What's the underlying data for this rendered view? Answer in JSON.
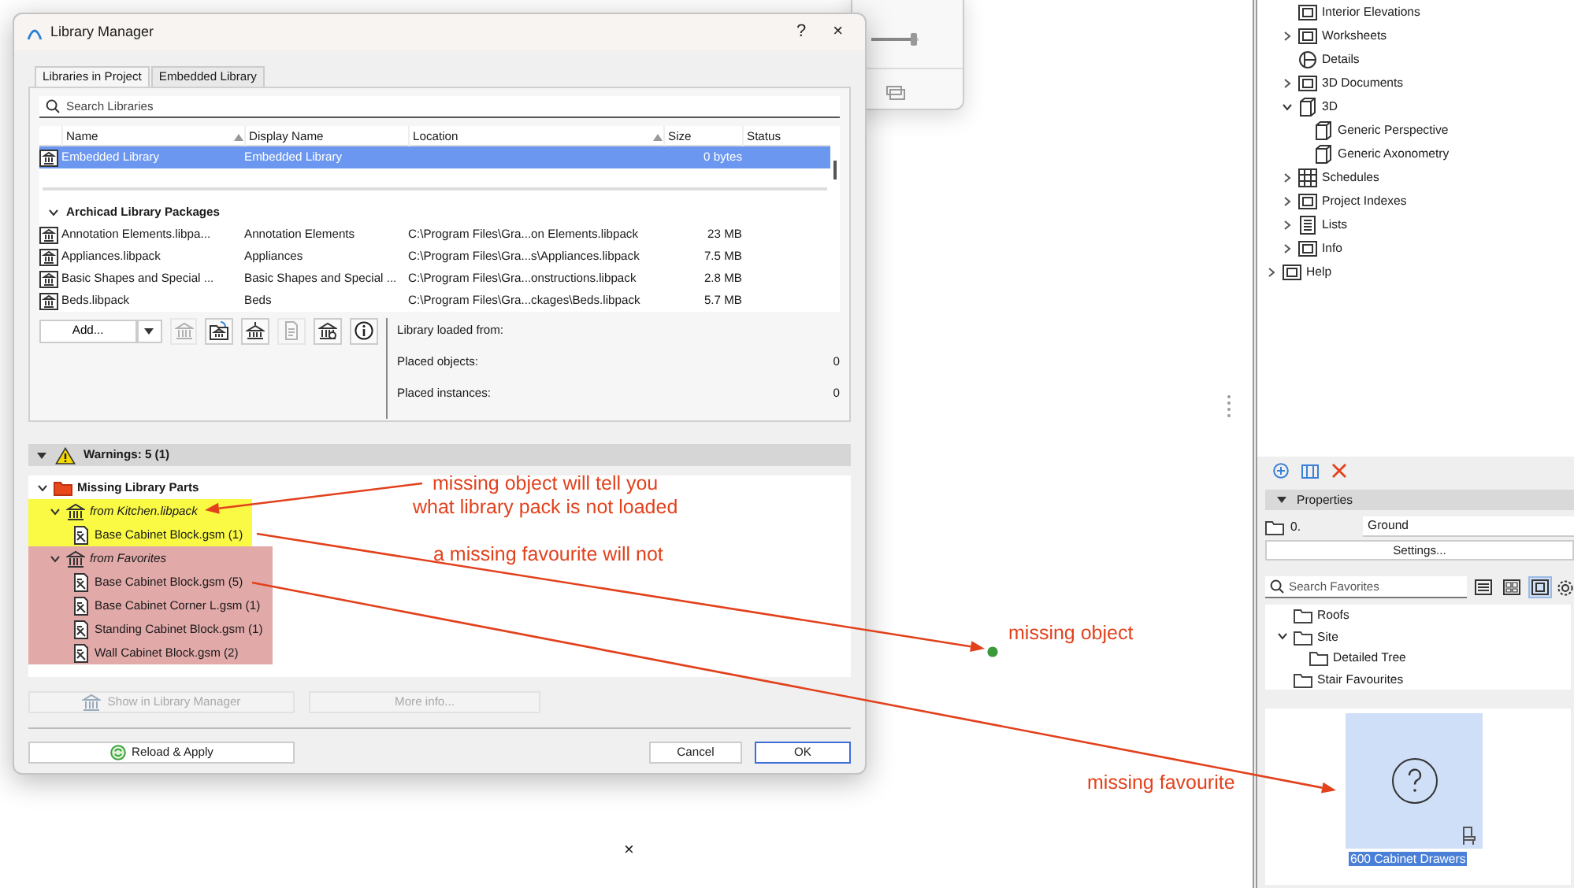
{
  "dialog": {
    "title": "Library Manager",
    "help": "?",
    "close": "×",
    "tabs": [
      {
        "label": "Libraries in Project",
        "selected": true
      },
      {
        "label": "Embedded Library",
        "selected": false
      }
    ],
    "search": {
      "placeholder": "Search Libraries"
    },
    "columns": [
      {
        "label": "Name",
        "sorted": true
      },
      {
        "label": "Display Name",
        "sorted": false
      },
      {
        "label": "Location",
        "sorted": true
      },
      {
        "label": "Size",
        "sorted": false
      },
      {
        "label": "Status",
        "sorted": false
      }
    ],
    "rows": [
      {
        "name": "Embedded Library",
        "display_name": "Embedded Library",
        "size": "0 bytes",
        "selected": true
      }
    ],
    "package_group": {
      "label": "Archicad Library Packages",
      "expanded": true,
      "rows": [
        {
          "name": "Annotation Elements.libpa...",
          "display_name": "Annotation Elements",
          "location": "C:\\Program Files\\Gra...on Elements.libpack",
          "size": "23 MB",
          "selected": false
        },
        {
          "name": "Appliances.libpack",
          "display_name": "Appliances",
          "location": "C:\\Program Files\\Gra...s\\Appliances.libpack",
          "size": "7.5 MB",
          "selected": false
        },
        {
          "name": "Basic Shapes and Special ...",
          "display_name": "Basic Shapes and Special ...",
          "location": "C:\\Program Files\\Gra...onstructions.libpack",
          "size": "2.8 MB",
          "selected": false
        },
        {
          "name": "Beds.libpack",
          "display_name": "Beds",
          "location": "C:\\Program Files\\Gra...ckages\\Beds.libpack",
          "size": "5.7 MB",
          "selected": false
        }
      ]
    },
    "add_button": "Add...",
    "tools": [
      {
        "disabled": true
      },
      {
        "disabled": false
      },
      {
        "disabled": false
      },
      {
        "disabled": true
      },
      {
        "disabled": false
      },
      {
        "disabled": false
      }
    ],
    "info": [
      {
        "label": "Library loaded from:"
      },
      {
        "label": "Placed objects:",
        "value": "0"
      },
      {
        "label": "Placed instances:",
        "value": "0"
      }
    ],
    "warnings": {
      "label": "Warnings: 5 (1)",
      "expanded": true
    },
    "missing": {
      "label": "Missing Library Parts",
      "expanded": true,
      "children": [
        {
          "label": "from Kitchen.libpack",
          "expanded": true,
          "color": "#fafa44",
          "children": [
            {
              "label": "Base Cabinet Block.gsm (1)"
            }
          ]
        },
        {
          "label": "from Favorites",
          "expanded": true,
          "color": "#e2a9a9",
          "children": [
            {
              "label": "Base Cabinet Block.gsm (5)"
            },
            {
              "label": "Base Cabinet Corner L.gsm (1)"
            },
            {
              "label": "Standing Cabinet Block.gsm (1)"
            },
            {
              "label": "Wall Cabinet Block.gsm (2)"
            }
          ]
        }
      ]
    },
    "show_button": {
      "label": "Show in Library Manager",
      "disabled": true
    },
    "more_button": {
      "label": "More info...",
      "disabled": true
    },
    "reload_button": "Reload & Apply",
    "cancel_button": "Cancel",
    "ok_button": {
      "label": "OK",
      "default": true
    }
  },
  "background_window": {
    "slider": {
      "level": 0.9
    }
  },
  "navigator": {
    "items": [
      {
        "label": "Interior Elevations",
        "kind": "leaf"
      },
      {
        "label": "Worksheets",
        "kind": "branch",
        "expanded": false
      },
      {
        "label": "Details",
        "kind": "leaf"
      },
      {
        "label": "3D Documents",
        "kind": "branch",
        "expanded": false
      },
      {
        "label": "3D",
        "kind": "branch",
        "expanded": true,
        "children": [
          {
            "label": "Generic Perspective",
            "kind": "leaf"
          },
          {
            "label": "Generic Axonometry",
            "kind": "leaf"
          }
        ]
      },
      {
        "label": "Schedules",
        "kind": "branch",
        "expanded": false
      },
      {
        "label": "Project Indexes",
        "kind": "branch",
        "expanded": false
      },
      {
        "label": "Lists",
        "kind": "branch",
        "expanded": false
      },
      {
        "label": "Info",
        "kind": "branch",
        "expanded": false
      }
    ],
    "top_level_items": [
      {
        "label": "Help",
        "kind": "branch",
        "expanded": false
      }
    ]
  },
  "properties": {
    "title": "Properties",
    "expanded": true,
    "layer_number": "0.",
    "layer_name": "Ground",
    "settings_button": "Settings..."
  },
  "favorites": {
    "search": {
      "placeholder": "Search Favorites"
    },
    "view_modes": [
      {
        "selected": false
      },
      {
        "selected": false
      },
      {
        "selected": true
      }
    ],
    "tree": [
      {
        "label": "Roofs"
      },
      {
        "label": "Site",
        "expanded": true,
        "children": [
          {
            "label": "Detailed Tree"
          }
        ]
      },
      {
        "label": "Stair Favourites"
      }
    ],
    "tile": {
      "label": "600 Cabinet Drawers",
      "selected": true
    }
  },
  "annotations": [
    {
      "lines": [
        "missing object will tell you",
        "what library pack is not loaded"
      ]
    },
    {
      "lines": [
        "a missing favourite will not"
      ]
    },
    {
      "lines": [
        "missing object"
      ]
    },
    {
      "lines": [
        "missing favourite"
      ]
    }
  ],
  "desktop_mark": "×"
}
